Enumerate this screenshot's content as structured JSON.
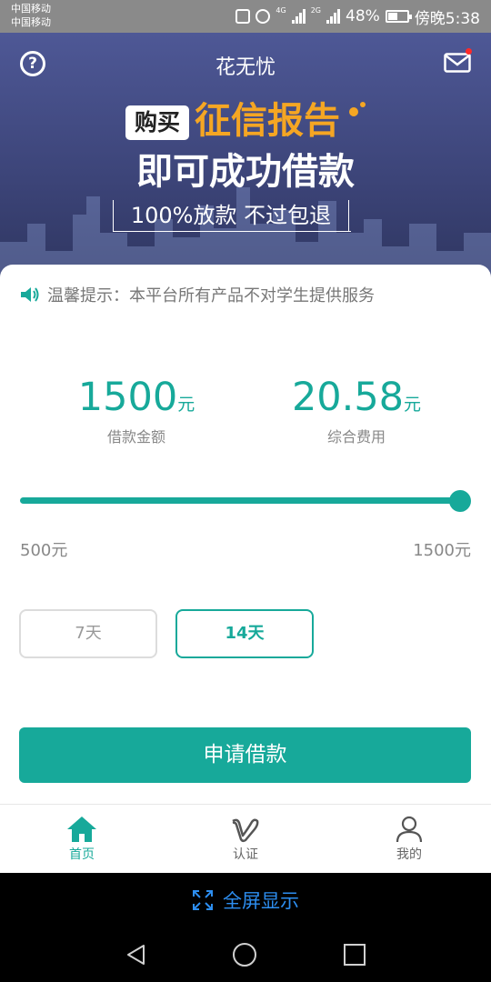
{
  "status_bar": {
    "carrier1": "中国移动",
    "carrier2": "中国移动",
    "net_tag1": "4G",
    "net_tag2": "2G",
    "battery": "48%",
    "time": "傍晚5:38"
  },
  "header": {
    "title": "花无忧",
    "help_icon": "help-circle-icon",
    "mail_icon": "mail-icon",
    "mail_dot_color": "#ff2a2a"
  },
  "banner": {
    "buy_tag": "购买",
    "headline1": "征信报告",
    "headline2": "即可成功借款",
    "slogan": "100%放款   不过包退"
  },
  "notice": {
    "icon": "speaker-icon",
    "text": "温馨提示：本平台所有产品不对学生提供服务"
  },
  "loan": {
    "amount": "1500",
    "amount_unit": "元",
    "amount_label": "借款金额",
    "fee": "20.58",
    "fee_unit": "元",
    "fee_label": "综合费用",
    "range_min": "500元",
    "range_max": "1500元",
    "slider_fraction": 1.0
  },
  "terms": {
    "options": [
      "7天",
      "14天"
    ],
    "selected": "14天"
  },
  "apply_button": "申请借款",
  "tabs": [
    {
      "label": "首页",
      "icon": "home-icon",
      "active": true
    },
    {
      "label": "认证",
      "icon": "v-icon",
      "active": false
    },
    {
      "label": "我的",
      "icon": "person-icon",
      "active": false
    }
  ],
  "fullscreen": {
    "icon": "expand-icon",
    "label": "全屏显示"
  },
  "colors": {
    "accent": "#17a99a",
    "banner_top": "#4e5896",
    "headline_orange": "#f5a623",
    "fullscreen_blue": "#2d8ef0"
  }
}
